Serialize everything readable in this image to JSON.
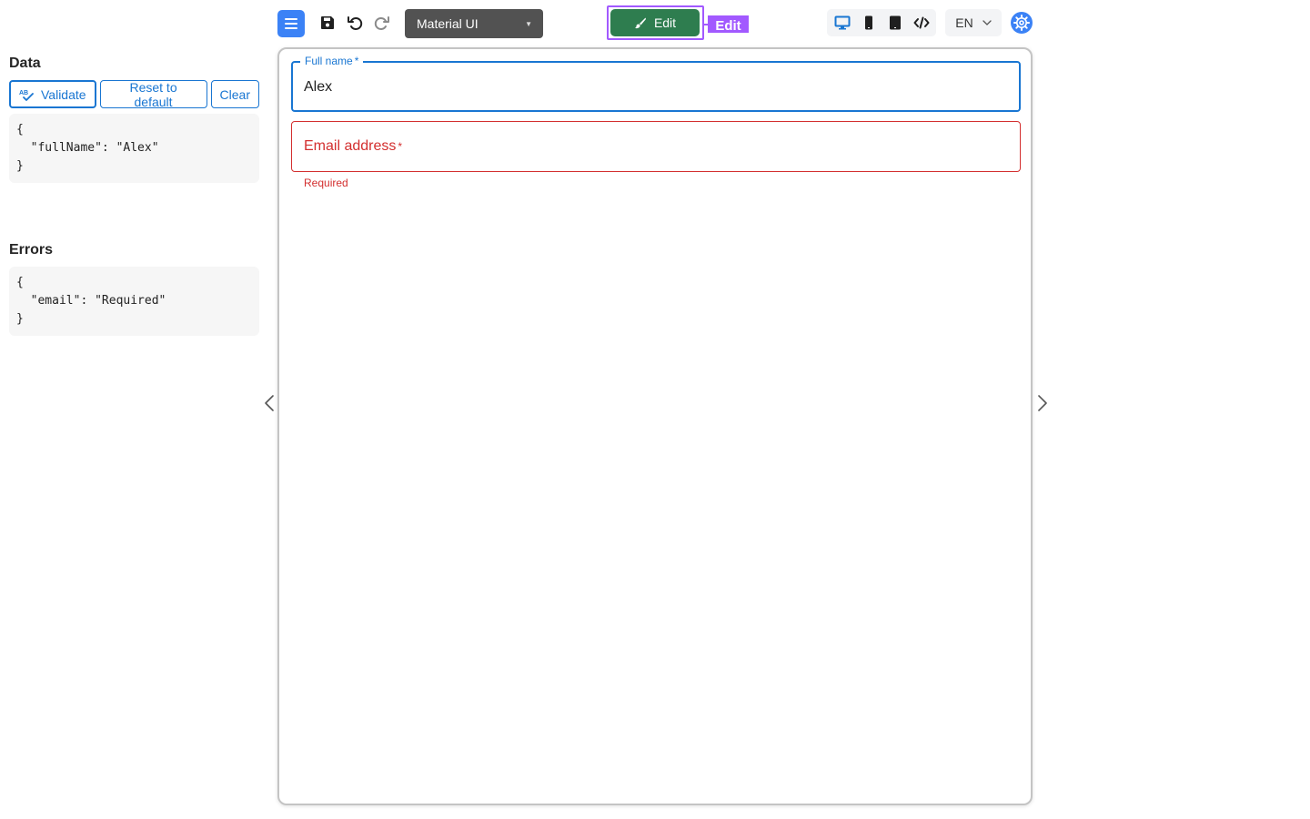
{
  "toolbar": {
    "theme_select_value": "Material UI",
    "edit_label": "Edit",
    "edit_tag": "Edit",
    "language": "EN",
    "accent_color": "#3b82f6",
    "edit_color": "#2e7d4f",
    "highlight_color": "#a259ff",
    "icons": [
      "menu-icon",
      "save-icon",
      "undo-icon",
      "redo-icon",
      "brush-icon",
      "desktop-icon",
      "mobile-icon",
      "tablet-icon",
      "code-icon",
      "chevron-down-icon",
      "settings-icon"
    ]
  },
  "left_panel": {
    "data_title": "Data",
    "validate_label": "Validate",
    "reset_label": "Reset to default",
    "clear_label": "Clear",
    "data_json": "{\n  \"fullName\": \"Alex\"\n}",
    "errors_title": "Errors",
    "errors_json": "{\n  \"email\": \"Required\"\n}"
  },
  "form": {
    "full_name_label": "Full name",
    "full_name_value": "Alex",
    "email_label": "Email address",
    "required_mark": "*",
    "email_error": "Required",
    "error_color": "#d32f2f",
    "focus_color": "#1976d2"
  }
}
